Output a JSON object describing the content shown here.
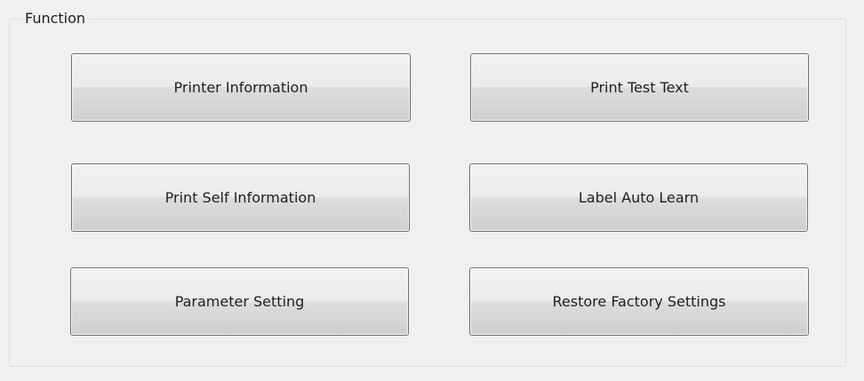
{
  "group": {
    "title": "Function"
  },
  "buttons": {
    "printer_information": "Printer Information",
    "print_test_text": "Print Test Text",
    "print_self_information": "Print Self Information",
    "label_auto_learn": "Label Auto Learn",
    "parameter_setting": "Parameter Setting",
    "restore_factory_settings": "Restore Factory Settings"
  }
}
